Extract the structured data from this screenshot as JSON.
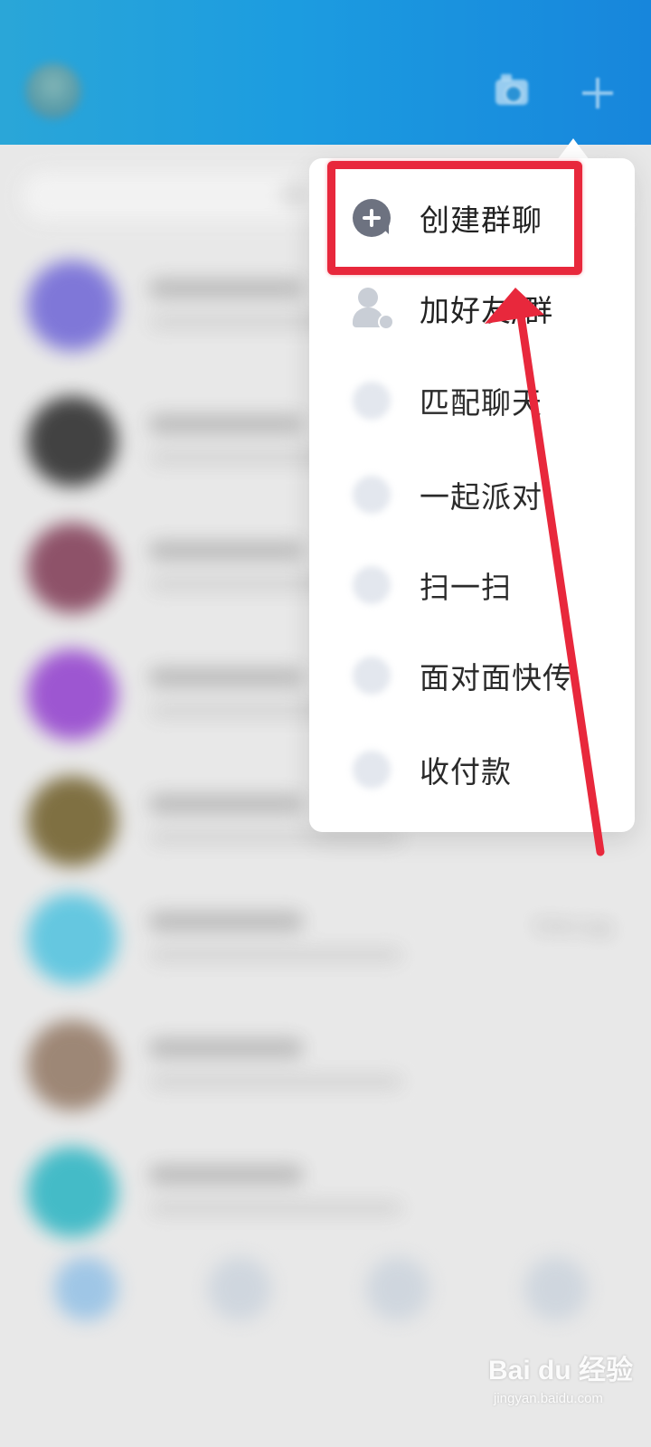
{
  "header": {
    "camera_icon": "camera-icon",
    "plus_icon": "plus-icon"
  },
  "chat_list": {
    "search_icon": "search-icon",
    "rows": [
      {
        "avatar_color": "#7a72d8",
        "time": ""
      },
      {
        "avatar_color": "#3a3a3a",
        "time": ""
      },
      {
        "avatar_color": "#8a4b63",
        "time": ""
      },
      {
        "avatar_color": "#9a4fd0",
        "time": ""
      },
      {
        "avatar_color": "#7a6a3a",
        "time": ""
      },
      {
        "avatar_color": "#5ec6e0",
        "time": "下午7:01"
      },
      {
        "avatar_color": "#9a8270",
        "time": ""
      },
      {
        "avatar_color": "#3cb9c6",
        "time": ""
      }
    ]
  },
  "menu": {
    "items": [
      {
        "label": "创建群聊",
        "icon": "plus-bubble-icon"
      },
      {
        "label": "加好友/群",
        "icon": "add-friend-icon"
      },
      {
        "label": "匹配聊天",
        "icon": "match-chat-icon"
      },
      {
        "label": "一起派对",
        "icon": "party-icon"
      },
      {
        "label": "扫一扫",
        "icon": "scan-icon"
      },
      {
        "label": "面对面快传",
        "icon": "transfer-icon"
      },
      {
        "label": "收付款",
        "icon": "payment-icon"
      }
    ]
  },
  "overlay": {
    "highlight_color": "#e8283c"
  },
  "watermark": {
    "logo": "Bai du 经验",
    "sub": "jingyan.baidu.com"
  }
}
